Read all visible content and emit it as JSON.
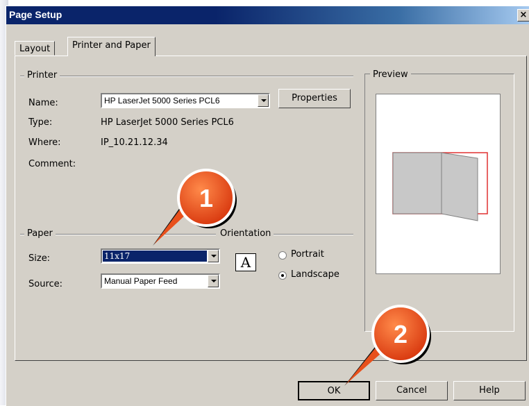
{
  "window": {
    "title": "Page Setup",
    "close_glyph": "×"
  },
  "tabs": [
    {
      "label": "Layout",
      "active": false
    },
    {
      "label": "Printer and Paper",
      "active": true
    }
  ],
  "printer": {
    "group_label": "Printer",
    "name_label": "Name:",
    "name_value": "HP LaserJet 5000 Series PCL6",
    "properties_button": "Properties",
    "type_label": "Type:",
    "type_value": "HP LaserJet 5000 Series PCL6",
    "where_label": "Where:",
    "where_value": "IP_10.21.12.34",
    "comment_label": "Comment:"
  },
  "paper": {
    "group_label": "Paper",
    "size_label": "Size:",
    "size_value": "11x17",
    "source_label": "Source:",
    "source_value": "Manual Paper Feed"
  },
  "orientation": {
    "group_label": "Orientation",
    "icon_glyph": "A",
    "portrait_label": "Portrait",
    "landscape_label": "Landscape",
    "selected": "Landscape"
  },
  "preview": {
    "group_label": "Preview"
  },
  "buttons": {
    "ok": "OK",
    "cancel": "Cancel",
    "help": "Help"
  },
  "callouts": [
    {
      "number": "1",
      "color": "#e8501c"
    },
    {
      "number": "2",
      "color": "#e8501c"
    }
  ],
  "colors": {
    "title_bar": "#0a246a",
    "dialog_bg": "#d4d0c8",
    "selection": "#0a246a",
    "preview_border": "#e03030"
  }
}
